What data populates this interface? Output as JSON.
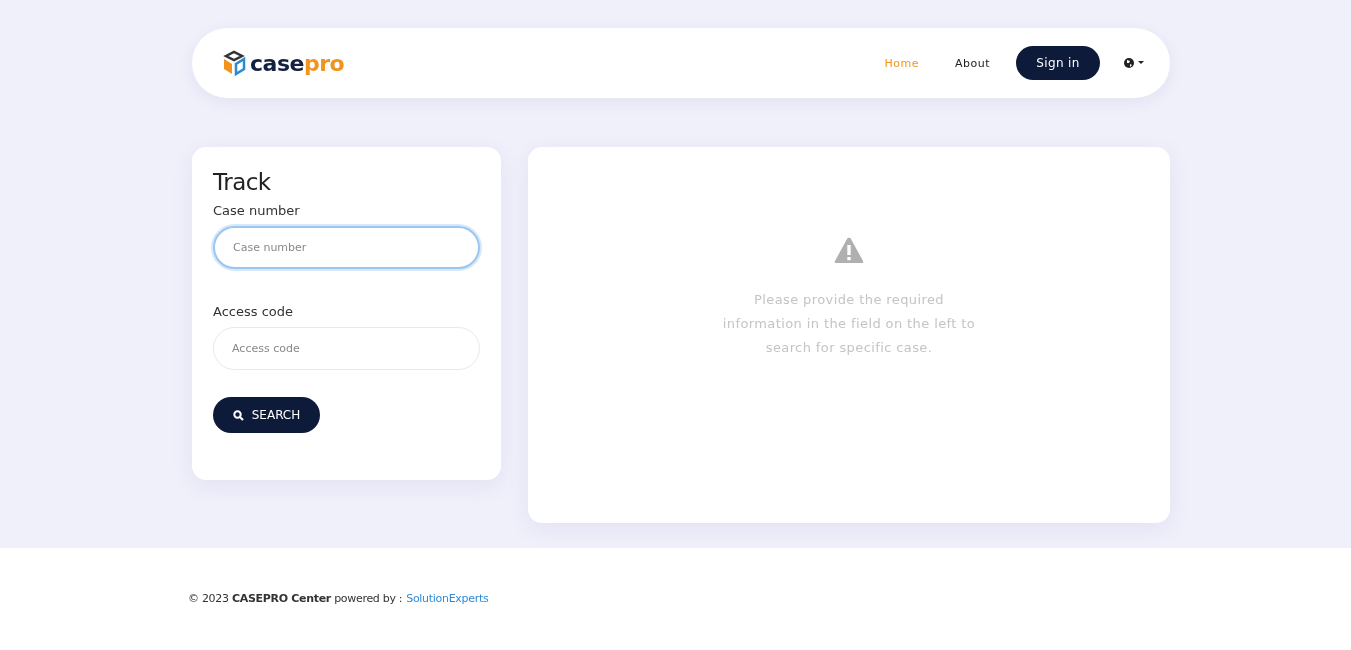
{
  "logo": {
    "primary": "case",
    "accent": "pro"
  },
  "nav": [
    {
      "label": "Home",
      "selected": true
    },
    {
      "label": "About",
      "selected": false
    }
  ],
  "sign_in": "Sign in",
  "track": {
    "title": "Track",
    "fields": [
      {
        "label": "Case number",
        "placeholder": "Case number",
        "focused": true
      },
      {
        "label": "Access code",
        "placeholder": "Access code",
        "focused": false
      }
    ],
    "button": "SEARCH"
  },
  "notice": {
    "message": "Please provide the required information in the field on the left to search for specific case."
  },
  "footer": {
    "text": "© 2023 **CASEPRO Center** powered by :",
    "link": "SolutionExperts"
  }
}
